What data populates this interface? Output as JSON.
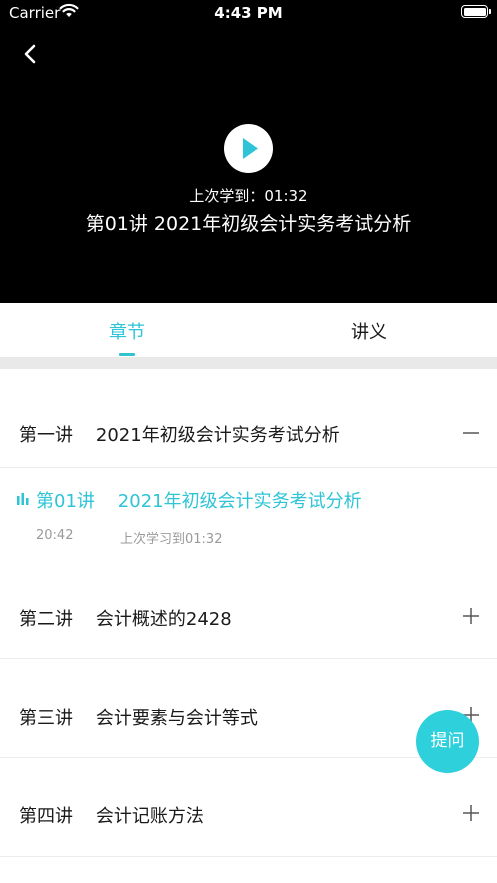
{
  "status_bar": {
    "carrier": "Carrier",
    "time": "4:43 PM"
  },
  "video": {
    "last_learned": "上次学到：01:32",
    "title": "第01讲    2021年初级会计实务考试分析"
  },
  "tabs": [
    {
      "label": "章节",
      "active": true
    },
    {
      "label": "讲义",
      "active": false
    }
  ],
  "chapters": [
    {
      "label": "第一讲    2021年初级会计实务考试分析",
      "expanded": true
    },
    {
      "label": "第二讲    会计概述的2428",
      "expanded": false
    },
    {
      "label": "第三讲    会计要素与会计等式",
      "expanded": false
    },
    {
      "label": "第四讲    会计记账方法",
      "expanded": false
    }
  ],
  "current_lesson": {
    "title": "第01讲    2021年初级会计实务考试分析",
    "duration": "20:42",
    "progress": "上次学习到01:32"
  },
  "ask_button": {
    "label": "提问"
  },
  "colors": {
    "accent": "#2ec4d6",
    "video_bg": "#000000",
    "divider": "#e9e9e9"
  }
}
